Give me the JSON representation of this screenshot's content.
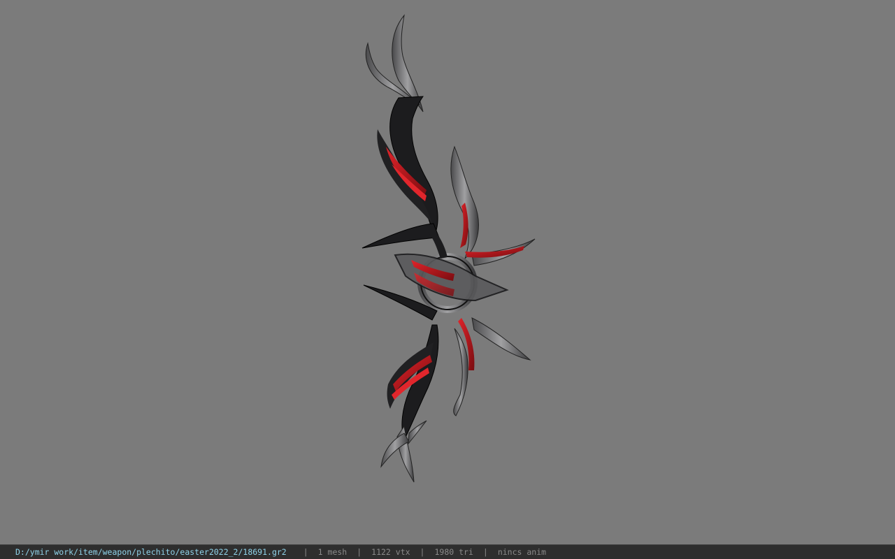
{
  "viewer": {
    "background_color": "#7b7b7b",
    "model": {
      "kind": "weapon-bow",
      "icon": "bow-model-icon",
      "colors": {
        "dark": "#1a1a1c",
        "metal": "#8c8c8c",
        "accent": "#c41a1e"
      }
    }
  },
  "statusbar": {
    "file_path": "D:/ymir work/item/weapon/plechito/easter2022_2/18691.gr2",
    "separator": "|",
    "mesh_count": "1 mesh",
    "vertex_count": "1122 vtx",
    "triangle_count": "1980 tri",
    "animation": "nincs anim",
    "text_color": "#8fd3ea",
    "muted_color": "#8a8a8a"
  }
}
